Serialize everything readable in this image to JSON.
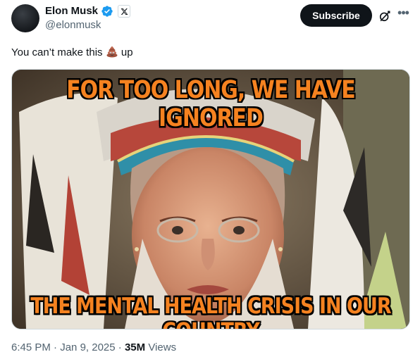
{
  "author": {
    "display_name": "Elon Musk",
    "handle": "@elonmusk"
  },
  "actions": {
    "subscribe_label": "Subscribe",
    "grok_icon": "grok-icon",
    "more_icon": "more-icon"
  },
  "tweet": {
    "text_before": "You can’t make this ",
    "emoji": "pile-of-poo",
    "text_after": " up"
  },
  "media": {
    "caption_top": "FOR TOO LONG, WE HAVE IGNORED",
    "caption_bottom": "THE MENTAL HEALTH CRISIS IN OUR COUNTRY"
  },
  "meta": {
    "time": "6:45 PM",
    "separator": " · ",
    "date": "Jan 9, 2025",
    "views_count": "35M",
    "views_label": "Views"
  },
  "colors": {
    "verified_blue": "#1d9bf0",
    "caption_orange": "#f58220",
    "subscribe_bg": "#0f1419"
  }
}
